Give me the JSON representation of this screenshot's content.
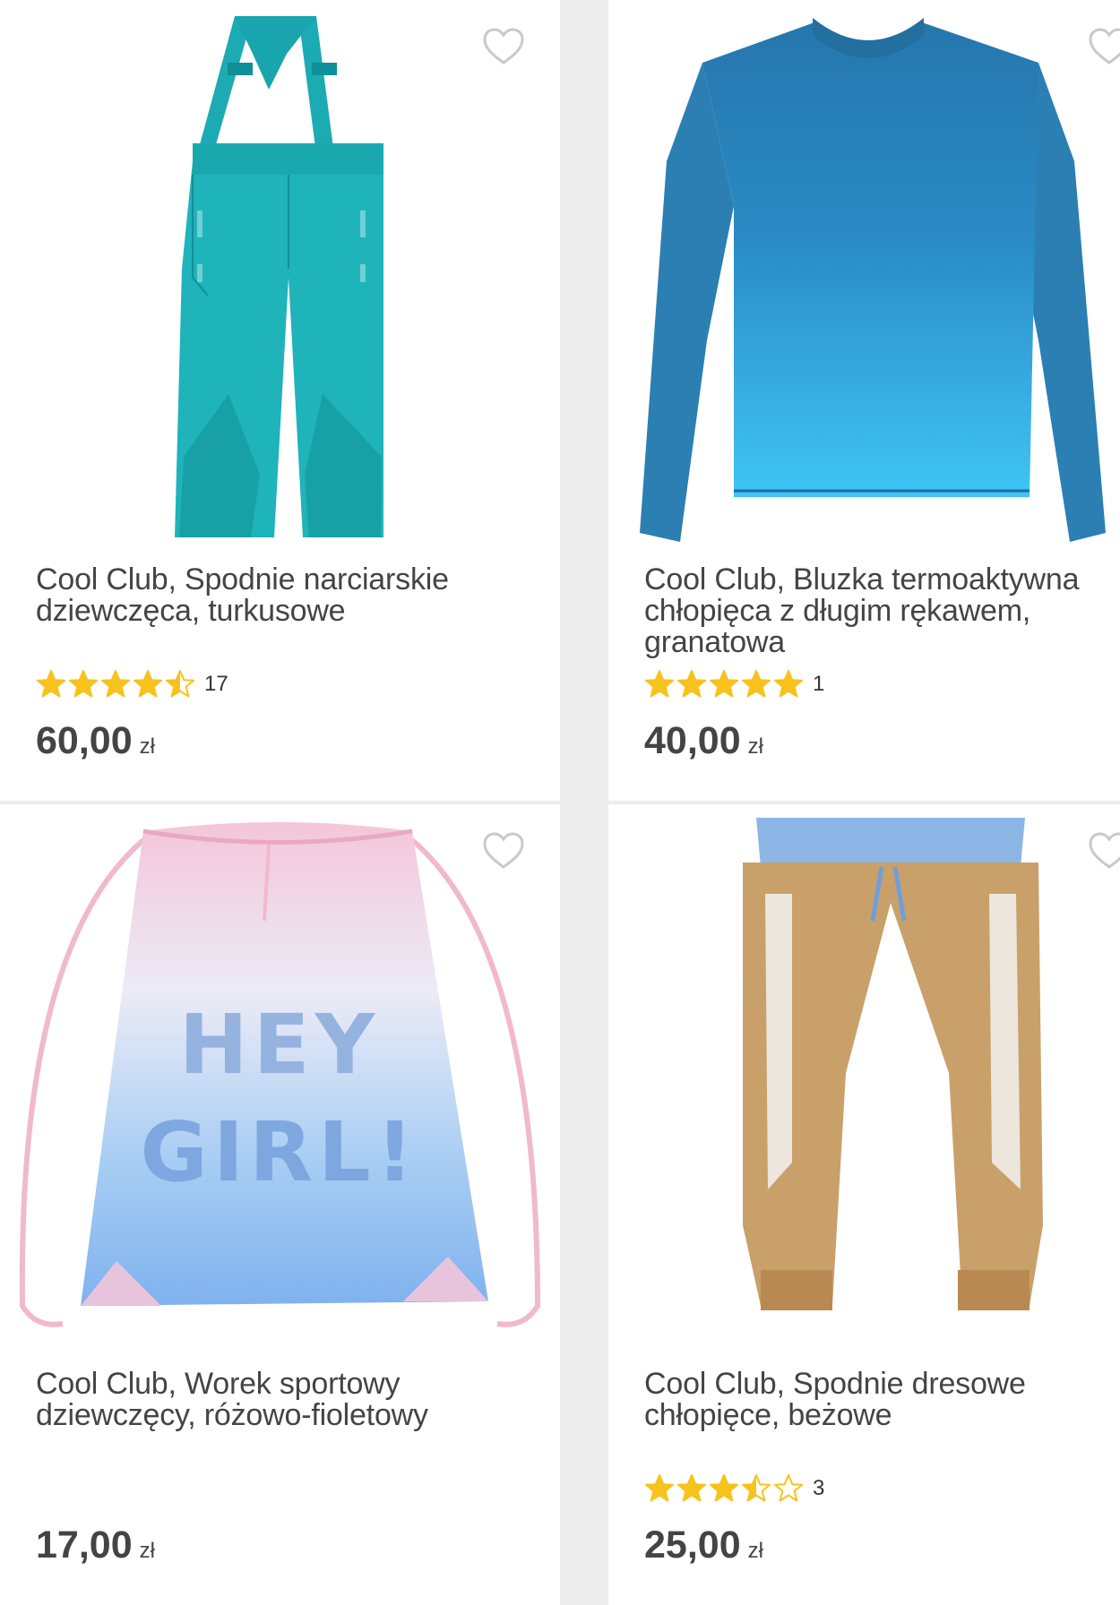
{
  "products": [
    {
      "title": "Cool Club, Spodnie narciarskie dziewczęca, turkusowe",
      "rating_count": "17",
      "rating": 4.5,
      "price": "60,00",
      "currency": "zł",
      "image": "turquoise-ski-pants",
      "color": "#1fb3ba"
    },
    {
      "title": "Cool Club, Bluzka termoaktywna chłopięca z długim rękawem, granatowa",
      "rating_count": "1",
      "rating": 5,
      "price": "40,00",
      "currency": "zł",
      "image": "blue-gradient-long-sleeve-top",
      "color": "#2f86b8"
    },
    {
      "title": "Cool Club, Worek sportowy dziewczęcy, różowo-fioletowy",
      "price": "17,00",
      "currency": "zł",
      "image": "pink-blue-drawstring-bag",
      "bag_text": "HEY GIRL!",
      "color": "#8fb8ee"
    },
    {
      "title": "Cool Club, Spodnie dresowe chłopięce, beżowe",
      "rating_count": "3",
      "rating": 3.5,
      "price": "25,00",
      "currency": "zł",
      "image": "beige-fleece-joggers",
      "color": "#c9a06a"
    }
  ],
  "star_color": "#f7c21c",
  "favorite_icon": "heart-outline-icon"
}
